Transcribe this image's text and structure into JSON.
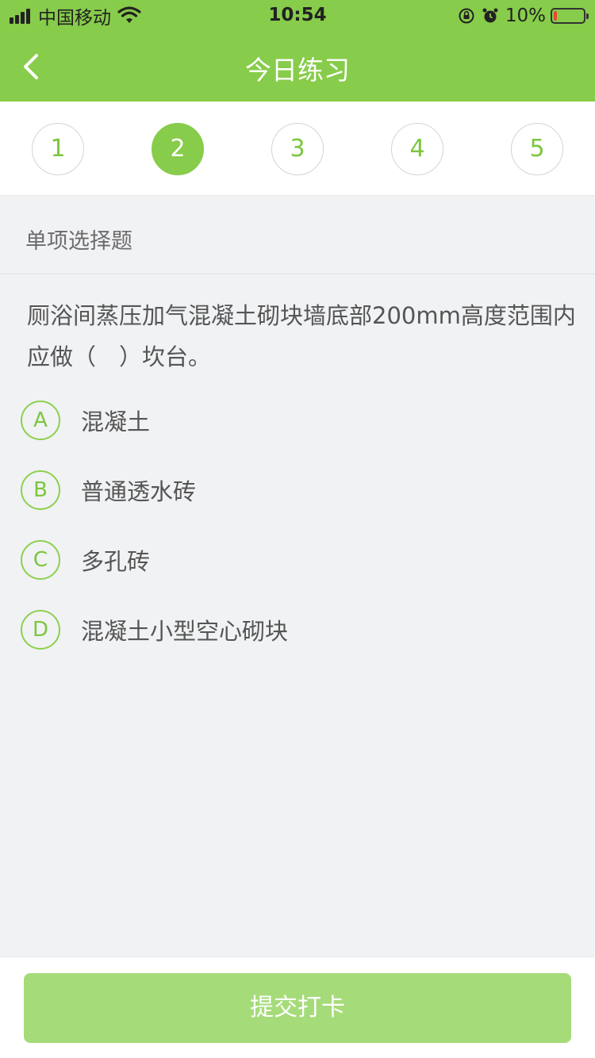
{
  "status_bar": {
    "carrier": "中国移动",
    "time": "10:54",
    "battery_percent_label": "10%",
    "battery_level": 0.1,
    "icons": [
      "signal-icon",
      "wifi-icon",
      "rotation-lock-icon",
      "alarm-icon",
      "battery-icon"
    ]
  },
  "nav": {
    "title": "今日练习",
    "back_icon": "chevron-left-icon"
  },
  "question_nav": {
    "items": [
      "1",
      "2",
      "3",
      "4",
      "5"
    ],
    "active": "2"
  },
  "section": {
    "label": "单项选择题"
  },
  "question": {
    "text": "厕浴间蒸压加气混凝土砌块墙底部200mm高度范围内应做（　）坎台。",
    "options": [
      {
        "letter": "A",
        "text": "混凝土"
      },
      {
        "letter": "B",
        "text": "普通透水砖"
      },
      {
        "letter": "C",
        "text": "多孔砖"
      },
      {
        "letter": "D",
        "text": "混凝土小型空心砌块"
      }
    ]
  },
  "footer": {
    "submit_label": "提交打卡"
  },
  "colors": {
    "accent": "#87cc4a",
    "accent_text": "#7cc63f",
    "submit_disabled": "#a6db7a",
    "background": "#f1f2f4"
  }
}
